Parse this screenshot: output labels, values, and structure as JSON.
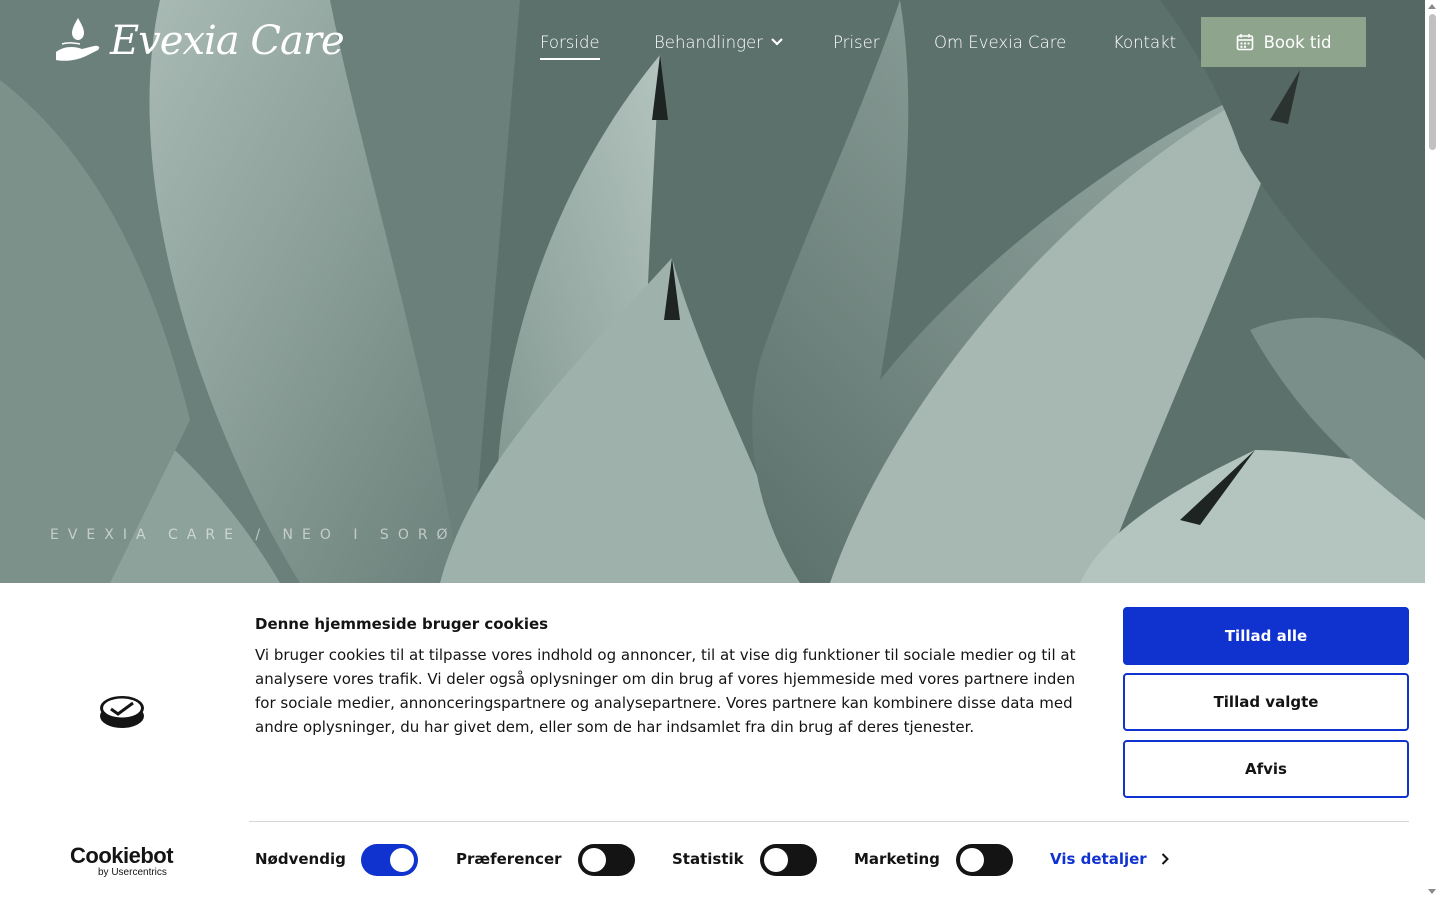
{
  "header": {
    "logo_text": "Evexia Care",
    "nav": [
      {
        "label": "Forside",
        "active": true
      },
      {
        "label": "Behandlinger",
        "has_dropdown": true
      },
      {
        "label": "Priser"
      },
      {
        "label": "Om Evexia Care"
      },
      {
        "label": "Kontakt"
      }
    ],
    "book_button": "Book tid",
    "book_button_color": "#8fa48d"
  },
  "hero": {
    "tagline": "EVEXIA CARE / NEO I SORØ"
  },
  "cookie_banner": {
    "title": "Denne hjemmeside bruger cookies",
    "text": "Vi bruger cookies til at tilpasse vores indhold og annoncer, til at vise dig funktioner til sociale medier og til at analysere vores trafik. Vi deler også oplysninger om din brug af vores hjemmeside med vores partnere inden for sociale medier, annonceringspartnere og analysepartnere. Vores partnere kan kombinere disse data med andre oplysninger, du har givet dem, eller som de har indsamlet fra din brug af deres tjenester.",
    "buttons": {
      "allow_all": "Tillad alle",
      "allow_selected": "Tillad valgte",
      "reject": "Afvis"
    },
    "toggles": [
      {
        "label": "Nødvendig",
        "on": true
      },
      {
        "label": "Præferencer",
        "on": false
      },
      {
        "label": "Statistik",
        "on": false
      },
      {
        "label": "Marketing",
        "on": false
      }
    ],
    "details_link": "Vis detaljer",
    "brand": {
      "name": "Cookiebot",
      "sub": "by Usercentrics"
    },
    "accent_color": "#1032cf"
  }
}
